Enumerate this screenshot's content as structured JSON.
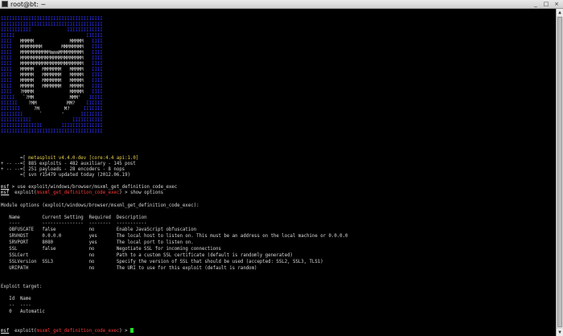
{
  "window": {
    "title": "root@bt: ~",
    "minimize": "_",
    "maximize": "□",
    "close": "×"
  },
  "banner": {
    "art": [
      "IIIIIIIIIIIIIIIIIIIIIIIIIIIIIIIIIIIII",
      "IIIIIIIIIIIIIIIIIIIIIIIIIIIIIIIIIIIII",
      "IIIIIIIIIII             IIIIIIIIIIIII",
      "IIIII                          IIIIII",
      "IIII   MMMMM             MMMMM   IIII",
      "IIII   MMMMMMMM       MMMMMMMM   IIII",
      "IIII   MMMMMMMMMMMmmmMMMMMMMMM   IIII",
      "IIII   MMMMMMMMMMMMMMMMMMMMMMM   IIII",
      "IIII   MMMMMMMMMMMMMMMMMMMMMMM   IIII",
      "IIII   MMMMM   MMMMMMM   MMMMM   IIII",
      "IIII   MMMMM   MMMMMMM   MMMMM   IIII",
      "IIII   MMMMM   MMMMMMM   MMMMM   IIII",
      "IIII   MMMMM   MMMMMMM   MMMMM   IIII",
      "IIII   ?MMMM             MMMMM   IIII",
      "IIIII   `?MM             MMM'   IIIII",
      "IIIIII    ?MM           MM?    IIIIII",
      "IIIIIII     ?M         M?     IIIIIII",
      "IIIIIIII      `       '      IIIIIIII",
      "IIIIIIIIIII               IIIIIIIIIII",
      "IIIIIIIIIIIIIII       IIIIIIIIIIIIIII",
      "IIIIIIIIIIIIIIIIIIIIIIIIIIIIIIIIIIIII"
    ],
    "line1_prefix": "       =[ ",
    "line1_text": "metasploit v4.4.0-dev [core:4.4 api:1.0]",
    "line2": "+ -- --=[ 885 exploits - 482 auxiliary - 145 post",
    "line3": "+ -- --=[ 251 payloads - 28 encoders - 8 nops",
    "line4": "       =[ svn r15479 updated today (2012.06.19)"
  },
  "commands": {
    "prompt": "msf",
    "cmd1": " > use exploit/windows/browser/msxml_get_definition_code_exec",
    "module_open": "  exploit(",
    "module_name": "msxml_get_definition_code_exec",
    "cmd2": ") > show options",
    "final_cmd": ") > "
  },
  "options": {
    "heading": "Module options (exploit/windows/browser/msxml_get_definition_code_exec):",
    "header": "   Name        Current Setting  Required  Description",
    "divider": "   ----        ---------------  --------  -----------",
    "rows": [
      "   OBFUSCATE   false            no        Enable JavaScript obfuscation",
      "   SRVHOST     0.0.0.0          yes       The local host to listen on. This must be an address on the local machine or 0.0.0.0",
      "   SRVPORT     8080             yes       The local port to listen on.",
      "   SSL         false            no        Negotiate SSL for incoming connections",
      "   SSLCert                      no        Path to a custom SSL certificate (default is randomly generated)",
      "   SSLVersion  SSL3             no        Specify the version of SSL that should be used (accepted: SSL2, SSL3, TLS1)",
      "   URIPATH                      no        The URI to use for this exploit (default is random)"
    ]
  },
  "target": {
    "heading": "Exploit target:",
    "header": "   Id  Name",
    "divider": "   --  ----",
    "row": "   0   Automatic"
  },
  "colors": {
    "banner_blue": "#3030ff",
    "version_yellow": "#e8d24a",
    "module_red": "#ff3a3a",
    "cursor_green": "#22e022"
  }
}
